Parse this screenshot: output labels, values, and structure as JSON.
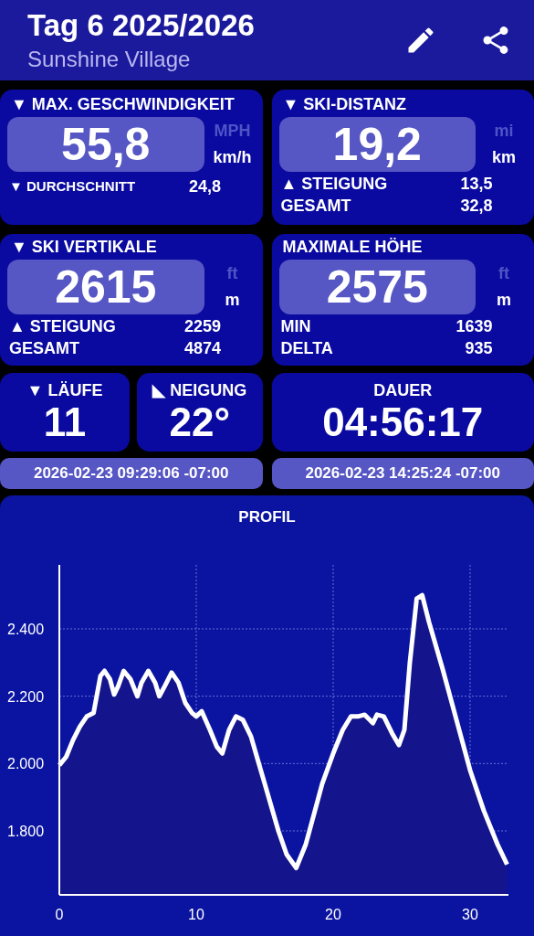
{
  "header": {
    "title": "Tag 6 2025/2026",
    "subtitle": "Sunshine Village"
  },
  "cards": [
    {
      "title": "▼ MAX. GESCHWINDIGKEIT",
      "value": "55,8",
      "units": [
        {
          "label": "MPH",
          "selected": false
        },
        {
          "label": "km/h",
          "selected": true
        }
      ],
      "rows": [
        {
          "label": "▼ DURCHSCHNITT",
          "value": "24,8"
        }
      ]
    },
    {
      "title": "▼ SKI-DISTANZ",
      "value": "19,2",
      "units": [
        {
          "label": "mi",
          "selected": false
        },
        {
          "label": "km",
          "selected": true
        }
      ],
      "rows": [
        {
          "label": "▲ STEIGUNG",
          "value": "13,5"
        },
        {
          "label": "GESAMT",
          "value": "32,8"
        }
      ]
    },
    {
      "title": "▼ SKI VERTIKALE",
      "value": "2615",
      "units": [
        {
          "label": "ft",
          "selected": false
        },
        {
          "label": "m",
          "selected": true
        }
      ],
      "rows": [
        {
          "label": "▲ STEIGUNG",
          "value": "2259"
        },
        {
          "label": "GESAMT",
          "value": "4874"
        }
      ]
    },
    {
      "title": "MAXIMALE HÖHE",
      "value": "2575",
      "units": [
        {
          "label": "ft",
          "selected": false
        },
        {
          "label": "m",
          "selected": true
        }
      ],
      "rows": [
        {
          "label": "MIN",
          "value": "1639"
        },
        {
          "label": "DELTA",
          "value": "935"
        }
      ]
    }
  ],
  "small_cards": [
    {
      "title": "▼ LÄUFE",
      "value": "11"
    },
    {
      "title": "◣ NEIGUNG",
      "value": "22°"
    },
    {
      "title": "DAUER",
      "value": "04:56:17"
    }
  ],
  "timestamps": [
    "2026-02-23 09:29:06 -07:00",
    "2026-02-23 14:25:24 -07:00"
  ],
  "profile": {
    "title": "PROFIL",
    "chart_data": {
      "type": "area",
      "xlim": [
        0,
        32.8
      ],
      "ylim": [
        1610,
        2590
      ],
      "xticks": [
        0,
        10,
        20,
        30
      ],
      "yticks": [
        {
          "value": 1800,
          "label": "1.800"
        },
        {
          "value": 2000,
          "label": "2.000"
        },
        {
          "value": 2200,
          "label": "2.200"
        },
        {
          "value": 2400,
          "label": "2.400"
        }
      ],
      "x": [
        0,
        0.5,
        1,
        1.5,
        2,
        2.5,
        3,
        3.3,
        3.7,
        4,
        4.3,
        4.7,
        5.2,
        5.7,
        6,
        6.5,
        7,
        7.3,
        7.7,
        8.2,
        8.7,
        9.2,
        9.7,
        10,
        10.4,
        11,
        11.5,
        11.9,
        12.4,
        12.9,
        13.4,
        14,
        14.5,
        15,
        15.5,
        16,
        16.6,
        17.3,
        18,
        18.6,
        19.2,
        20,
        20.7,
        21.3,
        21.8,
        22.3,
        22.9,
        23.2,
        23.7,
        24.3,
        24.8,
        25.2,
        25.6,
        26.1,
        26.5,
        27,
        28,
        29,
        30,
        31,
        32,
        32.7
      ],
      "grid": true,
      "series": [
        {
          "color": "#ffffff",
          "values": [
            1995,
            2020,
            2070,
            2110,
            2140,
            2150,
            2260,
            2275,
            2250,
            2205,
            2230,
            2275,
            2250,
            2200,
            2240,
            2275,
            2240,
            2200,
            2230,
            2270,
            2240,
            2180,
            2150,
            2140,
            2155,
            2100,
            2050,
            2030,
            2100,
            2140,
            2130,
            2080,
            2010,
            1940,
            1870,
            1800,
            1730,
            1690,
            1760,
            1850,
            1940,
            2030,
            2100,
            2140,
            2140,
            2145,
            2120,
            2145,
            2140,
            2090,
            2055,
            2100,
            2300,
            2490,
            2500,
            2420,
            2280,
            2130,
            1980,
            1860,
            1760,
            1700
          ]
        }
      ]
    }
  }
}
